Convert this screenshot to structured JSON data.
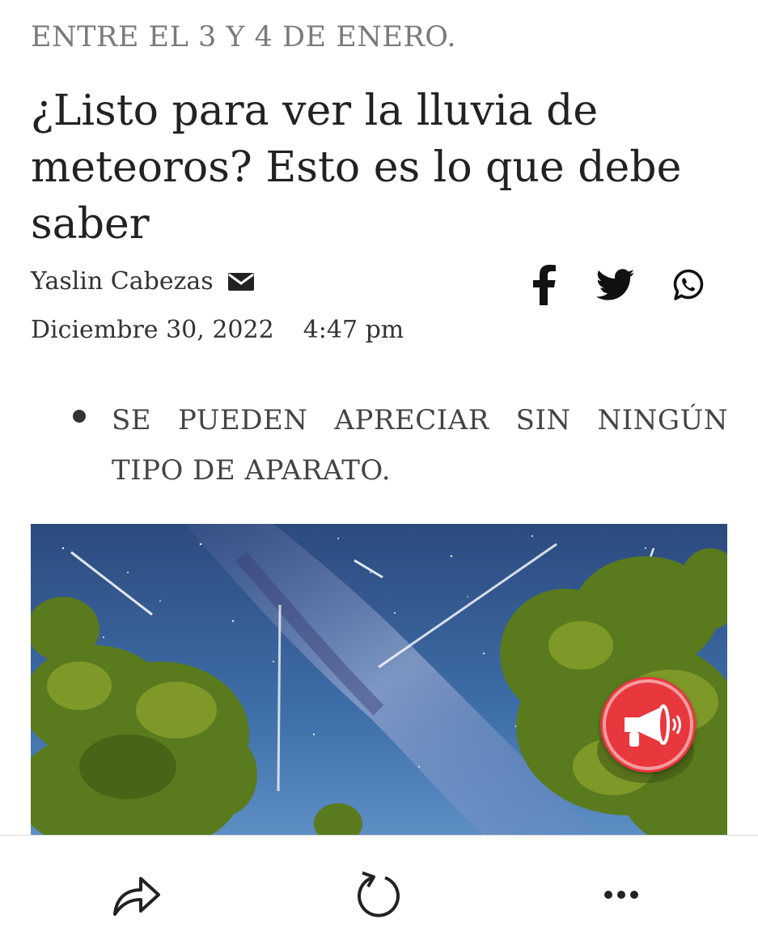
{
  "article": {
    "kicker": "ENTRE EL 3 Y 4 DE ENERO.",
    "title": "¿Listo para ver la lluvia de meteoros? Esto es lo que debe saber",
    "author": "Yaslin Cabezas",
    "date": "Diciembre 30, 2022",
    "time": "4:47 pm",
    "bullets": [
      "SE PUEDEN APRECIAR SIN NINGÚN TIPO DE APARATO."
    ]
  },
  "share": {
    "icons": [
      "facebook-icon",
      "twitter-icon",
      "whatsapp-icon"
    ]
  },
  "image": {
    "description_icon": "meteor-shower-photo"
  },
  "audio_button": {
    "icon": "megaphone-icon",
    "color": "#e9373e"
  },
  "toolbar": {
    "icons": [
      "share-icon",
      "refresh-icon",
      "more-icon"
    ]
  }
}
